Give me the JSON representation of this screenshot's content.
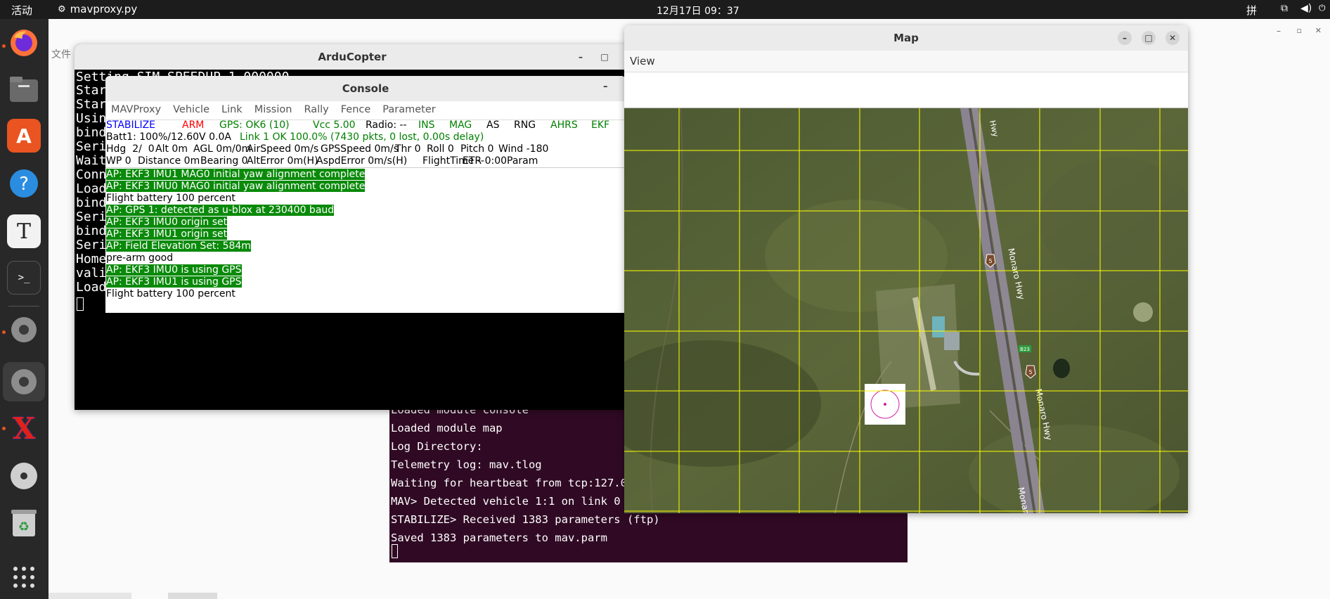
{
  "topbar": {
    "activities": "活动",
    "app_name": "mavproxy.py",
    "clock": "12月17日  09：37",
    "ime": "拼"
  },
  "bg_window": {
    "menu_label": "文件"
  },
  "dock": {
    "items": [
      "firefox-icon",
      "files-icon",
      "app-center-icon",
      "help-icon",
      "text-editor-icon",
      "terminal-icon",
      "settings-icon",
      "settings-active-icon",
      "xterm-icon",
      "disc-icon",
      "trash-icon",
      "show-apps-icon"
    ]
  },
  "terminal_bottom": {
    "lines": [
      "Loaded module console",
      "Loaded module map",
      "Log Directory:",
      "Telemetry log: mav.tlog",
      "Waiting for heartbeat from tcp:127.0.",
      "MAV> Detected vehicle 1:1 on link 0",
      "STABILIZE> Received 1383 parameters (ftp)",
      "Saved 1383 parameters to mav.parm"
    ]
  },
  "arducopter": {
    "title": "ArduCopter",
    "first_line": "Setting SIM_SPEEDUP 1.000000",
    "left_lines": [
      "Start",
      "Start",
      "Using",
      "bind",
      "Seria",
      "Wait",
      "Conne",
      "Loade",
      "bind",
      "Seria",
      "bind",
      "Seria",
      "Home",
      "valid",
      "Loade"
    ]
  },
  "console": {
    "title": "Console",
    "menu": [
      "MAVProxy",
      "Vehicle",
      "Link",
      "Mission",
      "Rally",
      "Fence",
      "Parameter"
    ],
    "status1": {
      "mode": "STABILIZE",
      "arm": "ARM",
      "gps": "GPS: OK6 (10)",
      "vcc": "Vcc 5.00",
      "radio": "Radio: --",
      "ins": "INS",
      "mag": "MAG",
      "as": "AS",
      "rng": "RNG",
      "ahrs": "AHRS",
      "ekf": "EKF"
    },
    "status2": {
      "batt": "Batt1: 100%/12.60V 0.0A",
      "link": "Link 1 OK 100.0% (7430 pkts, 0 lost, 0.00s delay)"
    },
    "status3": [
      "Hdg  2/  0",
      "Alt 0m",
      "AGL 0m/0m",
      "AirSpeed 0m/s",
      "GPSSpeed 0m/s",
      "Thr 0",
      "Roll 0",
      "Pitch 0",
      "Wind -180"
    ],
    "status4": [
      "WP 0",
      "Distance 0m",
      "Bearing 0",
      "AltError 0m(H)",
      "AspdError 0m/s(H)",
      "FlightTime --",
      "ETR 0:00",
      "Param"
    ],
    "messages": [
      {
        "text": "AP: EKF3 IMU1 MAG0 initial yaw alignment complete",
        "hl": true
      },
      {
        "text": "AP: EKF3 IMU0 MAG0 initial yaw alignment complete",
        "hl": true
      },
      {
        "text": "Flight battery 100 percent",
        "hl": false
      },
      {
        "text": "AP: GPS 1: detected as u-blox at 230400 baud",
        "hl": true
      },
      {
        "text": "AP: EKF3 IMU0 origin set",
        "hl": true
      },
      {
        "text": "AP: EKF3 IMU1 origin set",
        "hl": true
      },
      {
        "text": "AP: Field Elevation Set: 584m",
        "hl": true
      },
      {
        "text": "pre-arm good",
        "hl": false
      },
      {
        "text": "AP: EKF3 IMU0 is using GPS",
        "hl": true
      },
      {
        "text": "AP: EKF3 IMU1 is using GPS",
        "hl": true
      },
      {
        "text": "Flight battery 100 percent",
        "hl": false
      }
    ]
  },
  "map": {
    "title": "Map",
    "menu": [
      "View"
    ],
    "road_labels": [
      "Monaro Hwy",
      "Monaro Hwy",
      "Monaro"
    ],
    "small_labels": [
      "Hwy",
      "5",
      "5",
      "B23"
    ]
  },
  "colors": {
    "green_hl": "#0a8a0a",
    "mode_blue": "#0000ff",
    "arm_red": "#ff0000",
    "status_green": "#008000",
    "terminal_bg": "#300a24",
    "grid_yellow": "#ffff00"
  }
}
